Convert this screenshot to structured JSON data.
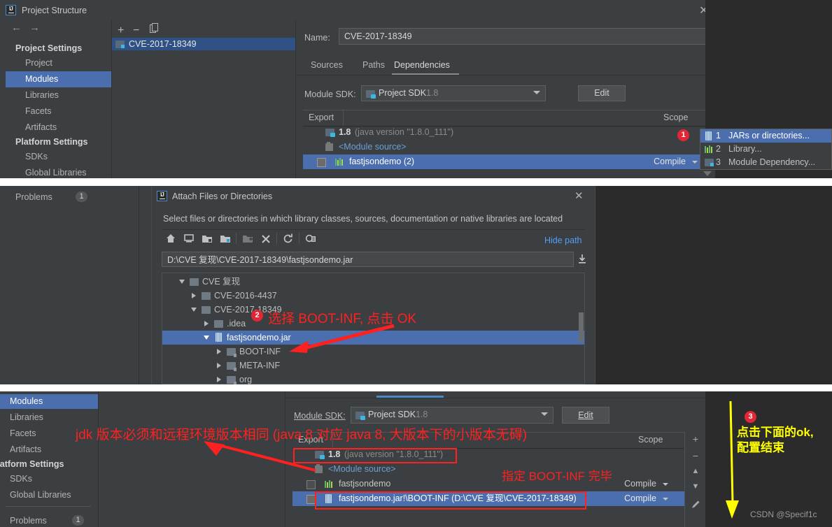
{
  "top_window": {
    "title": "Project Structure",
    "close_label": "✕",
    "nav": {
      "back": "←",
      "forward": "→"
    },
    "sidebar": {
      "sections": [
        {
          "header": "Project Settings",
          "items": [
            {
              "label": "Project",
              "selected": false
            },
            {
              "label": "Modules",
              "selected": true
            },
            {
              "label": "Libraries",
              "selected": false
            },
            {
              "label": "Facets",
              "selected": false
            },
            {
              "label": "Artifacts",
              "selected": false
            }
          ]
        },
        {
          "header": "Platform Settings",
          "items": [
            {
              "label": "SDKs",
              "selected": false
            },
            {
              "label": "Global Libraries",
              "selected": false
            }
          ]
        }
      ]
    },
    "module_toolbar": {
      "add": "+",
      "remove": "−",
      "copy": "copy-icon"
    },
    "module_list": [
      {
        "label": "CVE-2017-18349",
        "selected": true
      }
    ],
    "name_label": "Name:",
    "name_value": "CVE-2017-18349",
    "tabs": [
      {
        "label": "Sources",
        "active": false
      },
      {
        "label": "Paths",
        "active": false
      },
      {
        "label": "Dependencies",
        "active": true
      }
    ],
    "module_sdk_label": "Module SDK:",
    "module_sdk_value": "Project SDK",
    "module_sdk_version": "1.8",
    "edit_button": "Edit",
    "table": {
      "col_export": "Export",
      "col_scope": "Scope",
      "add_button": "+",
      "rows": [
        {
          "icon": "jdk-icon",
          "label": "1.8",
          "suffix": "(java version \"1.8.0_111\")",
          "scope": "",
          "checkbox": "none",
          "selected": false
        },
        {
          "icon": "module-source-icon",
          "label": "<Module source>",
          "suffix": "",
          "scope": "",
          "checkbox": "none",
          "selected": false
        },
        {
          "icon": "library-icon",
          "label": "fastjsondemo (2)",
          "suffix": "",
          "scope": "Compile",
          "checkbox": "checked",
          "selected": true
        }
      ]
    }
  },
  "add_menu": {
    "items": [
      {
        "num": "1",
        "label": "JARs or directories...",
        "icon": "jar-icon",
        "selected": true
      },
      {
        "num": "2",
        "label": "Library...",
        "icon": "library-icon",
        "selected": false
      },
      {
        "num": "3",
        "label": "Module Dependency...",
        "icon": "module-icon",
        "selected": false
      }
    ]
  },
  "attach_dialog": {
    "title": "Attach Files or Directories",
    "close_label": "✕",
    "subtitle": "Select files or directories in which library classes, sources, documentation or native libraries are located",
    "toolbar_icons": [
      "home-icon",
      "desktop-icon",
      "project-folder-icon",
      "module-folder-icon",
      "new-folder-icon",
      "delete-icon",
      "refresh-icon",
      "show-hidden-icon"
    ],
    "hide_path_link": "Hide path",
    "path_value": "D:\\CVE 复现\\CVE-2017-18349\\fastjsondemo.jar",
    "path_dropdown_icon": "download-icon",
    "tree": [
      {
        "label": "CVE 复现",
        "depth": 0,
        "expander": "down",
        "icon": "folder-icon",
        "selected": false
      },
      {
        "label": "CVE-2016-4437",
        "depth": 1,
        "expander": "right",
        "icon": "folder-icon",
        "selected": false
      },
      {
        "label": "CVE-2017-18349",
        "depth": 1,
        "expander": "down",
        "icon": "folder-icon",
        "selected": false
      },
      {
        "label": ".idea",
        "depth": 2,
        "expander": "right",
        "icon": "folder-icon",
        "selected": false
      },
      {
        "label": "fastjsondemo.jar",
        "depth": 2,
        "expander": "down",
        "icon": "jar-icon",
        "selected": true
      },
      {
        "label": "BOOT-INF",
        "depth": 3,
        "expander": "right",
        "icon": "jar-folder-icon",
        "selected": false
      },
      {
        "label": "META-INF",
        "depth": 3,
        "expander": "right",
        "icon": "jar-folder-icon",
        "selected": false
      },
      {
        "label": "org",
        "depth": 3,
        "expander": "right",
        "icon": "jar-folder-icon",
        "selected": false
      }
    ]
  },
  "bottom_window": {
    "sidebar": {
      "items": [
        {
          "label": "Modules",
          "selected": true
        },
        {
          "label": "Libraries",
          "selected": false
        },
        {
          "label": "Facets",
          "selected": false
        },
        {
          "label": "Artifacts",
          "selected": false
        }
      ],
      "platform_header": "Platform Settings",
      "platform_items": [
        {
          "label": "SDKs",
          "selected": false
        },
        {
          "label": "Global Libraries",
          "selected": false
        }
      ],
      "problems_label": "Problems",
      "problems_count": "1"
    },
    "module_sdk_label": "Module SDK:",
    "module_sdk_value": "Project SDK",
    "module_sdk_version": "1.8",
    "edit_button": "Edit",
    "table": {
      "col_export": "Export",
      "col_scope": "Scope",
      "rows": [
        {
          "icon": "jdk-icon",
          "label": "1.8",
          "suffix": "(java version \"1.8.0_111\")",
          "scope": "",
          "checkbox": "none",
          "selected": false,
          "highlighted": true
        },
        {
          "icon": "module-source-icon",
          "label": "<Module source>",
          "suffix": "",
          "scope": "",
          "checkbox": "none",
          "selected": false,
          "highlighted": false
        },
        {
          "icon": "library-icon",
          "label": "fastjsondemo",
          "suffix": "",
          "scope": "Compile",
          "checkbox": "empty",
          "selected": false,
          "highlighted": false
        },
        {
          "icon": "jar-icon",
          "label": "fastjsondemo.jar!\\BOOT-INF (D:\\CVE 复现\\CVE-2017-18349)",
          "suffix": "",
          "scope": "Compile",
          "checkbox": "checked",
          "selected": true,
          "highlighted": true
        }
      ]
    },
    "side_buttons": [
      "+",
      "−",
      "▲",
      "▼",
      "edit-pencil-icon"
    ]
  },
  "problems_bar": {
    "label": "Problems",
    "count": "1"
  },
  "annotations": [
    {
      "id": "1",
      "badge": "1",
      "text": ""
    },
    {
      "id": "2",
      "badge": "2",
      "text": "选择 BOOT-INF, 点击 OK"
    },
    {
      "id": "jdk",
      "badge": "",
      "text": "jdk 版本必须和远程环境版本相同 (java 8 对应 java 8, 大版本下的小版本无碍)"
    },
    {
      "id": "bootinf",
      "badge": "",
      "text": "指定 BOOT-INF 完毕"
    },
    {
      "id": "3",
      "badge": "3",
      "text": "点击下面的ok,",
      "text2": "配置结束"
    }
  ],
  "watermark": "CSDN @Specif1c",
  "colors": {
    "accent_blue": "#4b6eaf",
    "panel_bg": "#3c3f41",
    "dark_bg": "#2b2b2b",
    "annotation_red": "#ff2020",
    "annotation_yellow": "#ffff00",
    "link_blue": "#589df6"
  }
}
